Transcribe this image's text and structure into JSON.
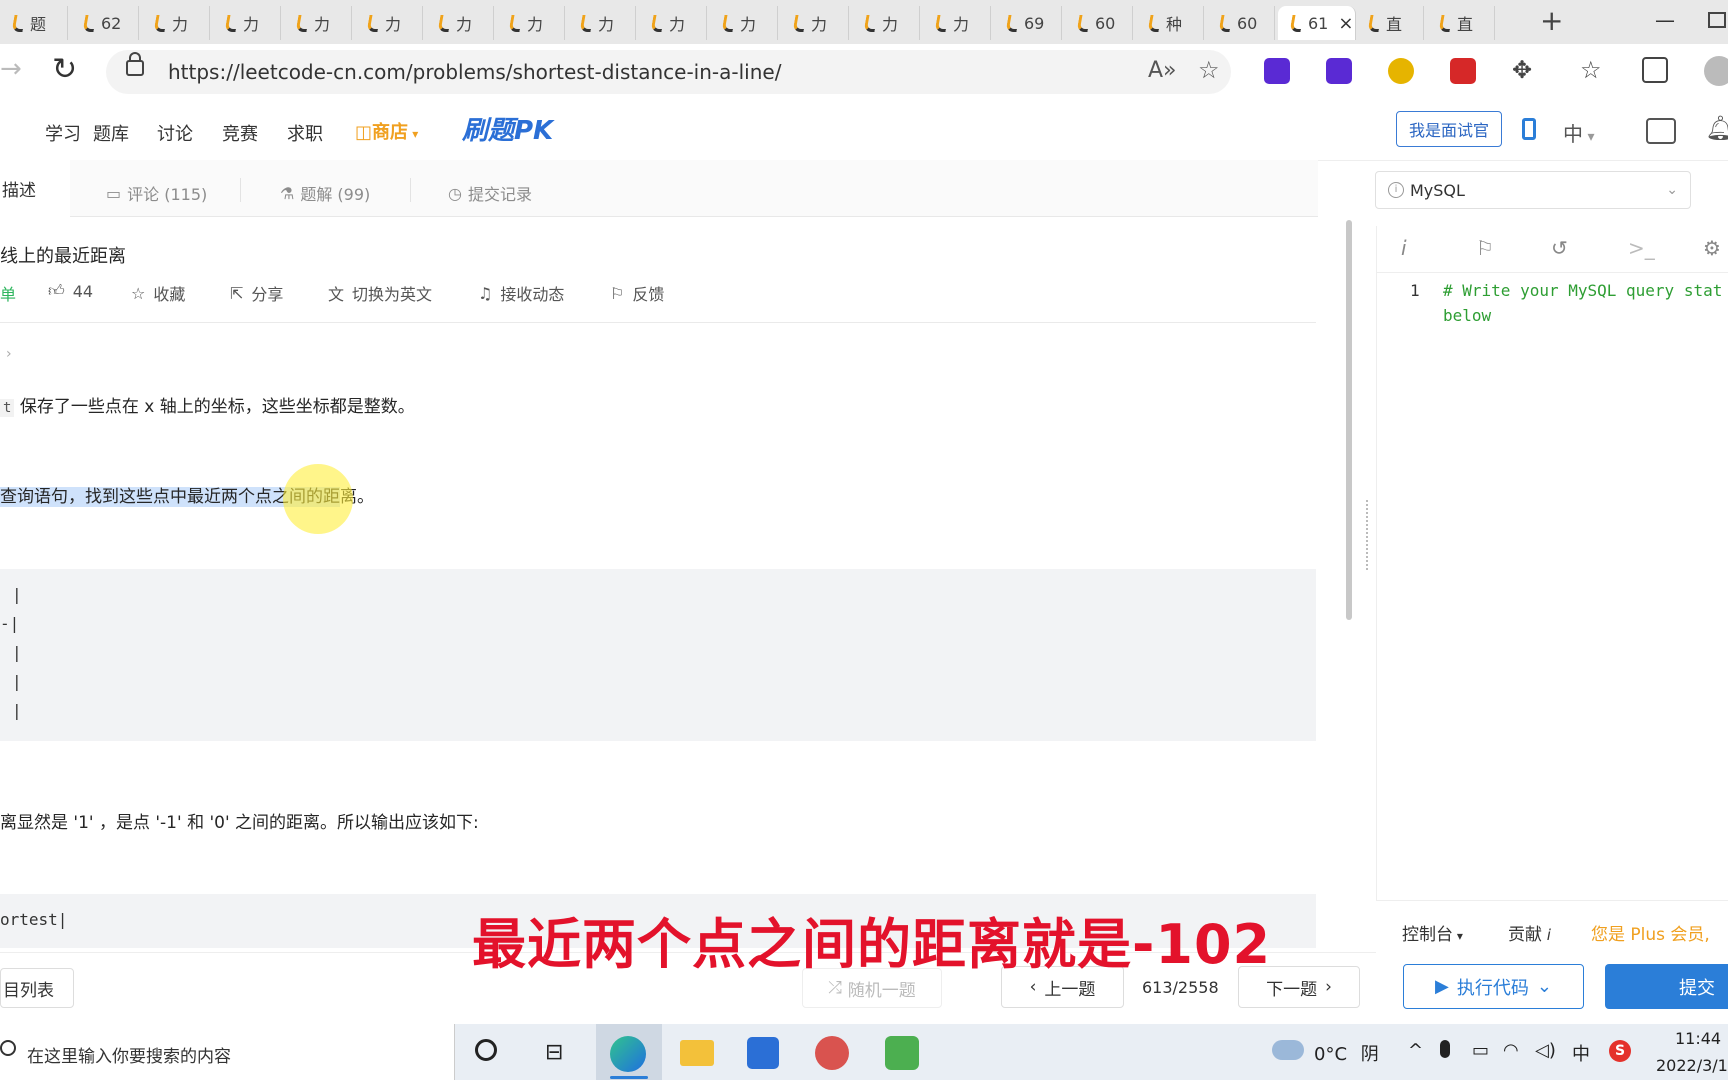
{
  "browser": {
    "tabs": [
      {
        "label": "题"
      },
      {
        "label": "62"
      },
      {
        "label": "力"
      },
      {
        "label": "力"
      },
      {
        "label": "力"
      },
      {
        "label": "力"
      },
      {
        "label": "力"
      },
      {
        "label": "力"
      },
      {
        "label": "力"
      },
      {
        "label": "力"
      },
      {
        "label": "力"
      },
      {
        "label": "力"
      },
      {
        "label": "力"
      },
      {
        "label": "力"
      },
      {
        "label": "69"
      },
      {
        "label": "60"
      },
      {
        "label": "种"
      },
      {
        "label": "60"
      },
      {
        "label": "61"
      },
      {
        "label": "直"
      },
      {
        "label": "直"
      }
    ],
    "active_tab_index": 18,
    "new_tab": "+",
    "minimize": "—",
    "url": "https://leetcode-cn.com/problems/shortest-distance-in-a-line/"
  },
  "site_nav": {
    "items": [
      "学习",
      "题库",
      "讨论",
      "竞赛",
      "求职"
    ],
    "store": "商店",
    "pk": "刷题PK",
    "interviewer_button": "我是面试官",
    "lang": "中"
  },
  "left_tabs": {
    "description": "描述",
    "comments": "评论 (115)",
    "solutions": "题解 (99)",
    "submissions": "提交记录"
  },
  "problem": {
    "title": "线上的最近距离",
    "difficulty_fragment": "单",
    "likes": "44",
    "favorite": "收藏",
    "share": "分享",
    "switch_english": "切换为英文",
    "follow": "接收动态",
    "feedback": "反馈",
    "desc_line1_code": "t",
    "desc_line1": "保存了一些点在 x 轴上的坐标，这些坐标都是整数。",
    "desc_line2_highlight": "查询语句，找到这些点中最近两个点之间的距",
    "desc_line2_rest": "离。",
    "block1_lines": [
      "|",
      "-|",
      "|",
      "|",
      "|"
    ],
    "desc_line3": "离显然是 '1' ，是点 '-1' 和 '0' 之间的距离。所以输出应该如下:",
    "block2_line": "ortest|"
  },
  "editor": {
    "language": "MySQL",
    "line_number": "1",
    "code_line1": "# Write your MySQL query stat",
    "code_line2": "below",
    "console": "控制台",
    "contribute": "贡献",
    "plus_note": "您是 Plus 会员,"
  },
  "bottom_bar": {
    "problem_list": "目列表",
    "random": "随机一题",
    "prev": "上一题",
    "counter": "613/2558",
    "next": "下一题",
    "run": "执行代码",
    "submit": "提交"
  },
  "subtitle": "最近两个点之间的距离就是-102",
  "taskbar": {
    "search_placeholder": "在这里输入你要搜索的内容",
    "temperature": "0°C",
    "weather": "阴",
    "ime": "中",
    "sogou": "S",
    "time": "11:44",
    "date": "2022/3/1"
  },
  "colors": {
    "accent": "#2b7ed8",
    "store": "#f0a020",
    "subtitle": "#e3122b",
    "code_comment": "#2e9e33"
  }
}
